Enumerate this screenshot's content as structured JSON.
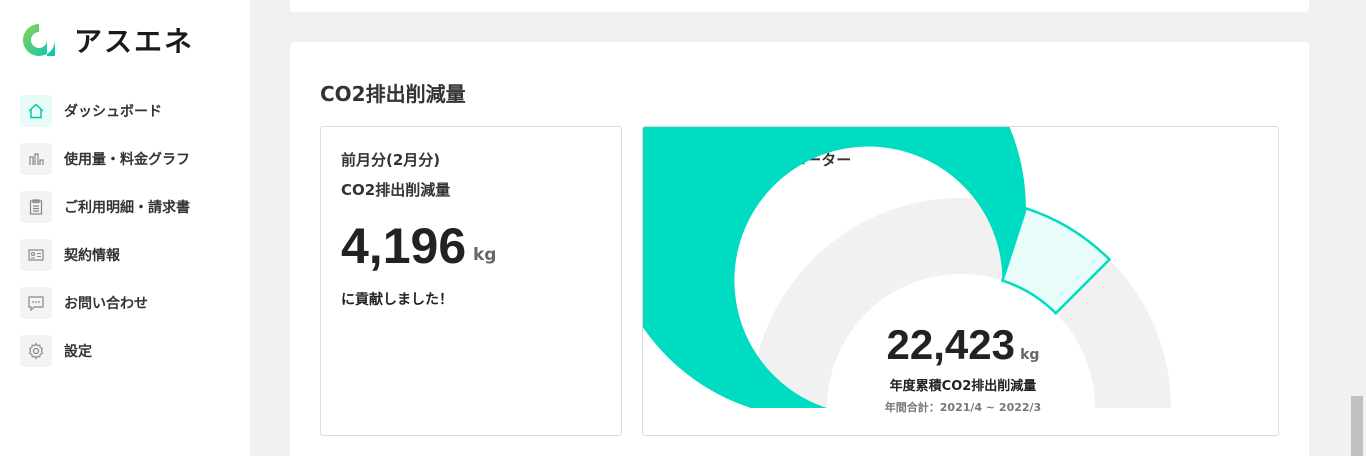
{
  "app": {
    "name": "アスエネ",
    "accent": "#00dcc1"
  },
  "sidebar": {
    "items": [
      {
        "label": "ダッシュボード",
        "icon": "home-icon",
        "active": true
      },
      {
        "label": "使用量・料金グラフ",
        "icon": "bar-chart-icon",
        "active": false
      },
      {
        "label": "ご利用明細・請求書",
        "icon": "clipboard-icon",
        "active": false
      },
      {
        "label": "契約情報",
        "icon": "id-card-icon",
        "active": false
      },
      {
        "label": "お問い合わせ",
        "icon": "chat-icon",
        "active": false
      },
      {
        "label": "設定",
        "icon": "gear-icon",
        "active": false
      }
    ]
  },
  "main": {
    "section_title": "CO2排出削減量",
    "monthly": {
      "line1": "前月分(2月分)",
      "line2": "CO2排出削減量",
      "value": "4,196",
      "unit": "kg",
      "message": "に貢献しました！"
    },
    "meter": {
      "title": "CO2排出削減貢献メーター",
      "value": "22,423",
      "unit": "kg",
      "label": "年度累積CO2排出削減量",
      "period": "年間合計：2021/4 ~ 2022/3",
      "filled_fraction": 0.6,
      "last_month_fraction": 0.15,
      "colors": {
        "filled": "#00dcc1",
        "last_month": "#e8fcfa",
        "remaining": "#f1f1f2"
      }
    }
  }
}
